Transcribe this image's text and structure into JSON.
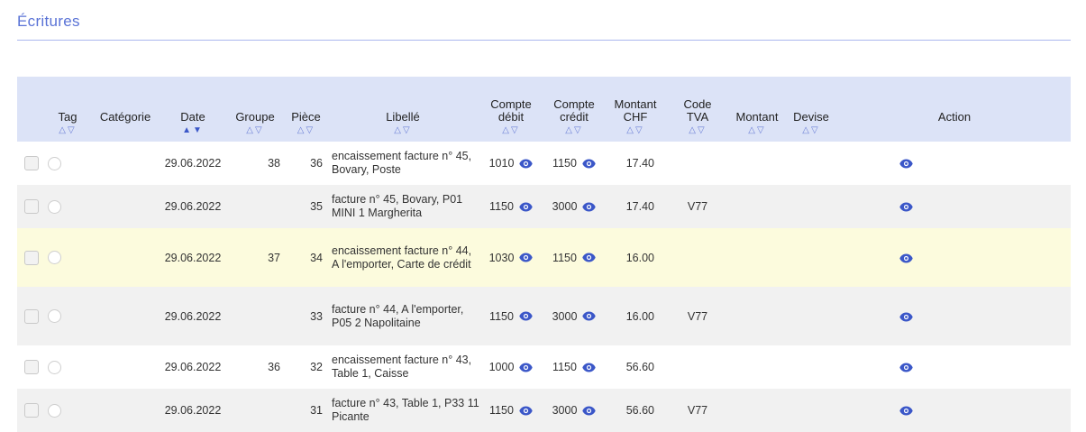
{
  "title": "Écritures",
  "headers": {
    "tag": "Tag",
    "categorie": "Catégorie",
    "date": "Date",
    "groupe": "Groupe",
    "piece": "Pièce",
    "libelle": "Libellé",
    "compte_debit_1": "Compte",
    "compte_debit_2": "débit",
    "compte_credit_1": "Compte",
    "compte_credit_2": "crédit",
    "montant_chf_1": "Montant",
    "montant_chf_2": "CHF",
    "code_tva_1": "Code",
    "code_tva_2": "TVA",
    "montant": "Montant",
    "devise": "Devise",
    "action": "Action"
  },
  "accent_color": "#3b57c8",
  "rows": [
    {
      "date": "29.06.2022",
      "groupe": "38",
      "piece": "36",
      "libelle": "encaissement facture n° 45, Bovary, Poste",
      "debit": "1010",
      "credit": "1150",
      "montant_chf": "17.40",
      "code_tva": "",
      "montant": "",
      "devise": ""
    },
    {
      "date": "29.06.2022",
      "groupe": "",
      "piece": "35",
      "libelle": "facture n° 45, Bovary, P01 MINI 1 Margherita",
      "debit": "1150",
      "credit": "3000",
      "montant_chf": "17.40",
      "code_tva": "V77",
      "montant": "",
      "devise": ""
    },
    {
      "date": "29.06.2022",
      "groupe": "37",
      "piece": "34",
      "libelle": "encaissement facture n° 44, A l'emporter, Carte de crédit",
      "debit": "1030",
      "credit": "1150",
      "montant_chf": "16.00",
      "code_tva": "",
      "montant": "",
      "devise": ""
    },
    {
      "date": "29.06.2022",
      "groupe": "",
      "piece": "33",
      "libelle": "facture n° 44, A l'emporter, P05 2 Napolitaine",
      "debit": "1150",
      "credit": "3000",
      "montant_chf": "16.00",
      "code_tva": "V77",
      "montant": "",
      "devise": ""
    },
    {
      "date": "29.06.2022",
      "groupe": "36",
      "piece": "32",
      "libelle": "encaissement facture n° 43, Table 1, Caisse",
      "debit": "1000",
      "credit": "1150",
      "montant_chf": "56.60",
      "code_tva": "",
      "montant": "",
      "devise": ""
    },
    {
      "date": "29.06.2022",
      "groupe": "",
      "piece": "31",
      "libelle": "facture n° 43, Table 1, P33 11 Picante",
      "debit": "1150",
      "credit": "3000",
      "montant_chf": "56.60",
      "code_tva": "V77",
      "montant": "",
      "devise": ""
    }
  ]
}
